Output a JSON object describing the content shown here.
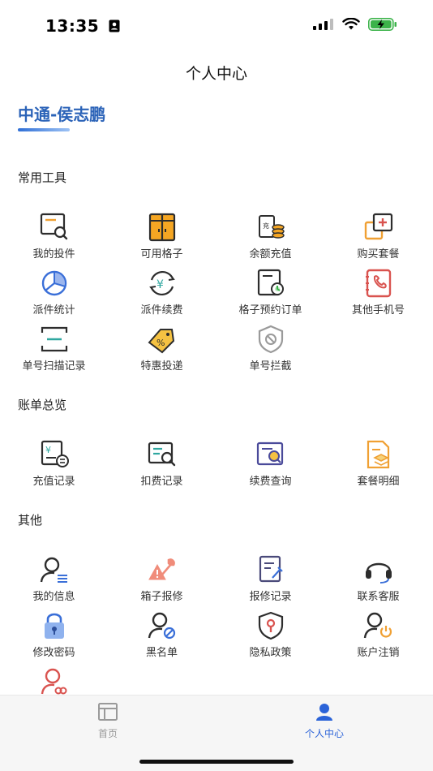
{
  "status": {
    "time": "13:35"
  },
  "header": {
    "title": "个人中心"
  },
  "user": {
    "name": "中通-侯志鹏"
  },
  "sections": {
    "tools": {
      "title": "常用工具",
      "items": [
        {
          "label": "我的投件",
          "icon": "my-deliveries-icon"
        },
        {
          "label": "可用格子",
          "icon": "available-lockers-icon"
        },
        {
          "label": "余额充值",
          "icon": "balance-recharge-icon"
        },
        {
          "label": "购买套餐",
          "icon": "buy-package-icon"
        },
        {
          "label": "派件统计",
          "icon": "delivery-stats-icon"
        },
        {
          "label": "派件续费",
          "icon": "delivery-renewal-icon"
        },
        {
          "label": "格子预约订单",
          "icon": "locker-reservation-icon"
        },
        {
          "label": "其他手机号",
          "icon": "other-phone-icon"
        },
        {
          "label": "单号扫描记录",
          "icon": "scan-record-icon"
        },
        {
          "label": "特惠投递",
          "icon": "discount-delivery-icon"
        },
        {
          "label": "单号拦截",
          "icon": "intercept-icon"
        }
      ]
    },
    "bills": {
      "title": "账单总览",
      "items": [
        {
          "label": "充值记录",
          "icon": "recharge-record-icon"
        },
        {
          "label": "扣费记录",
          "icon": "deduction-record-icon"
        },
        {
          "label": "续费查询",
          "icon": "renewal-query-icon"
        },
        {
          "label": "套餐明细",
          "icon": "package-detail-icon"
        }
      ]
    },
    "other": {
      "title": "其他",
      "items": [
        {
          "label": "我的信息",
          "icon": "my-info-icon"
        },
        {
          "label": "箱子报修",
          "icon": "box-repair-icon"
        },
        {
          "label": "报修记录",
          "icon": "repair-record-icon"
        },
        {
          "label": "联系客服",
          "icon": "customer-service-icon"
        },
        {
          "label": "修改密码",
          "icon": "lock-icon"
        },
        {
          "label": "黑名单",
          "icon": "blacklist-icon"
        },
        {
          "label": "隐私政策",
          "icon": "privacy-shield-icon"
        },
        {
          "label": "账户注销",
          "icon": "account-logout-icon"
        },
        {
          "label": "",
          "icon": "user-link-icon"
        }
      ]
    }
  },
  "tabbar": {
    "home_label": "首页",
    "profile_label": "个人中心",
    "active_color": "#2b63d8",
    "inactive_color": "#9a9a9a"
  }
}
